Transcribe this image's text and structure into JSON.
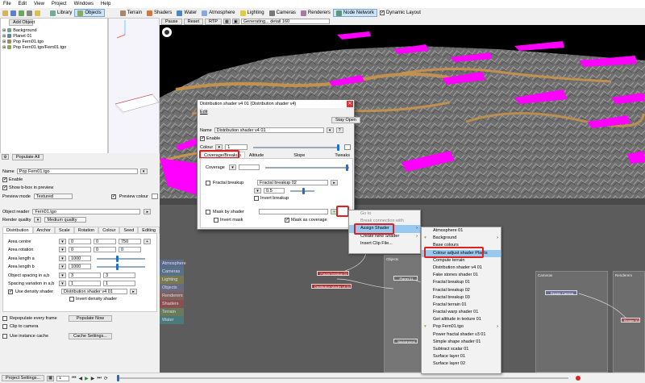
{
  "menubar": {
    "items": [
      "File",
      "Edit",
      "View",
      "Project",
      "Windows",
      "Help"
    ]
  },
  "toolbar": {
    "add_object": "Add Object",
    "library": "Library",
    "objects": "Objects",
    "terrain": "Terrain",
    "shaders": "Shaders",
    "water": "Water",
    "atmosphere": "Atmosphere",
    "lighting": "Lighting",
    "cameras": "Cameras",
    "renderers": "Renderers",
    "node_network": "Node Network",
    "dynamic_layout": "Dynamic Layout"
  },
  "render_controls": {
    "pause": "Pause",
    "reset": "Reset",
    "rtp": "RTP",
    "status": "Generating... detail 160"
  },
  "scene_tree": {
    "items": [
      "Background",
      "Planet 01",
      "Pop Fern01.tgo",
      "Pop Fern01.tgo/Fern01.tgo"
    ]
  },
  "populate_all": "Populate All",
  "object_panel": {
    "name_label": "Name",
    "name_value": "Pop Fern01.tgo",
    "enable": "Enable",
    "show_bbox": "Show b-box in preview",
    "preview_mode_label": "Preview mode",
    "preview_mode_value": "Textured",
    "preview_colour": "Preview colour",
    "object_reader_label": "Object reader",
    "object_reader_value": "Fern01.tgo",
    "render_quality_label": "Render quality",
    "render_quality_value": "Medium quality",
    "tabs": [
      "Distribution",
      "Anchor",
      "Scale",
      "Rotation",
      "Colour",
      "Seed",
      "Editing"
    ],
    "area_centre_label": "Area centre",
    "area_centre": [
      "0",
      "0",
      "750"
    ],
    "area_rotation_label": "Area rotation",
    "area_rotation": [
      "0",
      "0",
      "0"
    ],
    "area_length_a_label": "Area length a",
    "area_length_a": "1000",
    "area_length_b_label": "Area length b",
    "area_length_b": "1000",
    "object_spacing_label": "Object spacing in a,b",
    "object_spacing": [
      "3",
      "3"
    ],
    "spacing_variation_label": "Spacing variation in a,b",
    "spacing_variation": [
      "1",
      "1"
    ],
    "use_density_shader": "Use density shader",
    "density_shader_value": "Distribution shader v4 01",
    "invert_density": "Invert density shader",
    "repopulate": "Repopulate every frame",
    "populate_now": "Populate Now",
    "clip_camera": "Clip to camera",
    "instance_cache": "Use instance cache",
    "cache_settings": "Cache Settings..."
  },
  "bottom_bar": {
    "project_settings": "Project Settings...",
    "frame": "1"
  },
  "dialog": {
    "title": "Distribution shader v4 01   (Distribution shader v4)",
    "edit": "Edit",
    "stay_open": "Stay Open",
    "name_label": "Name",
    "name_value": "Distribution shader v4 01",
    "enable": "Enable",
    "colour_label": "Colour",
    "colour_value": "1",
    "tabs": [
      "Coverage/Breakup",
      "Altitude constraints",
      "Slope constraints",
      "Tweaks"
    ],
    "coverage_label": "Coverage",
    "fractal_breakup": "Fractal breakup",
    "fractal_breakup_value": "Fractal breakup 02",
    "fractal_val": "0.5",
    "invert_breakup": "Invert breakup",
    "mask_by_shader": "Mask by shader",
    "invert_mask": "Invert mask",
    "mask_as_coverage": "Mask as coverage"
  },
  "context_menu": {
    "items": [
      "Go to",
      "Break connection with",
      "Assign Shader",
      "Create New Shader",
      "Insert Clip File..."
    ]
  },
  "submenu": {
    "items": [
      "Atmosphere 01",
      "Background",
      "Base colours",
      "Colour adjust shader Plants",
      "Compute terrain",
      "Distribution shader v4 01",
      "Fake stones shader 01",
      "Fractal breakup 01",
      "Fractal breakup 02",
      "Fractal breakup 03",
      "Fractal terrain 01",
      "Fractal warp shader 01",
      "Get altitude in texture 01",
      "Pop Fern01.tgo",
      "Power fractal shader v3 01",
      "Simple shape shader 01",
      "Subtract scalar 01",
      "Surface layer 01",
      "Surface layer 02"
    ]
  },
  "node_categories": [
    "Atmosphere",
    "Cameras",
    "Lighting",
    "Objects",
    "Renderers",
    "Shaders",
    "Terrain",
    "Water"
  ],
  "nodes": {
    "objects": "Objects",
    "cameras": "Cameras",
    "renderers": "Renderers",
    "render_camera": "Render Camera",
    "render01": "Render 01",
    "fractal_breakup": "Fractal breakup 02",
    "planet": "Planet 01",
    "background": "Background",
    "dist_shader": "Distribution shader v4 01"
  },
  "colors": {
    "selection": "#cce4f7",
    "highlight": "#e02020",
    "magenta": "#ff00ff",
    "node_bg": "#3a3a3a",
    "menu_sel": "#99c9ef"
  }
}
